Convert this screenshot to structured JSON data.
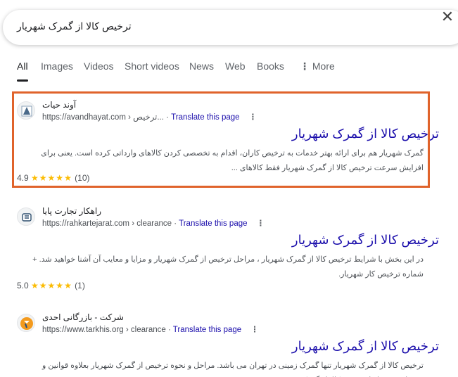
{
  "search": {
    "query": "ترخیص کالا از گمرک شهریار",
    "clear_icon": "close-icon"
  },
  "tabs": [
    {
      "label": "All",
      "active": true
    },
    {
      "label": "Images"
    },
    {
      "label": "Videos"
    },
    {
      "label": "Short videos"
    },
    {
      "label": "News"
    },
    {
      "label": "Web"
    },
    {
      "label": "Books"
    },
    {
      "label": "More"
    }
  ],
  "results": [
    {
      "site_name": "آوند حیات",
      "url": "https://avandhayat.com › ترخیص...",
      "translate": "Translate this page",
      "title": "ترخیص کالا از گمرک شهریار",
      "snippet": "گمرک شهریار هم برای ارائه بهتر خدمات به ترخیص کاران، اقدام به تخصصی کردن کالاهای وارداتی کرده است. یعنی برای افزایش سرعت ترخیص کالا از گمرک شهریار فقط کالاهای ...",
      "rating": "4.9",
      "stars": "★★★★★",
      "reviews": "(10)"
    },
    {
      "site_name": "راهکار تجارت پایا",
      "url": "https://rahkartejarat.com › clearance",
      "translate": "Translate this page",
      "title": "ترخیص کالا از گمرک شهریار",
      "snippet": "در این بخش با شرایط ترخیص کالا از گمرک شهریار ، مراحل ترخیص از گمرک شهریار و مزایا و معایب آن آشنا خواهید شد. + شماره ترخیص کار شهریار.",
      "rating": "5.0",
      "stars": "★★★★★",
      "reviews": "(1)"
    },
    {
      "site_name": "شرکت - بازرگانی احدی",
      "url": "https://www.tarkhis.org › clearance",
      "translate": "Translate this page",
      "title": "ترخیص کالا از گمرک شهریار",
      "snippet": "ترخیص کالا از گمرک شهریار تنها گمرک زمینی در تهران می باشد. مراحل و نحوه ترخیص از گمرک شهریار بعلاوه قوانین و مقررات و شرایط ترخیص کالا از گمرک ..."
    }
  ],
  "colors": {
    "link": "#1a0dab",
    "highlight": "#e0632b",
    "star": "#fbbc04"
  }
}
